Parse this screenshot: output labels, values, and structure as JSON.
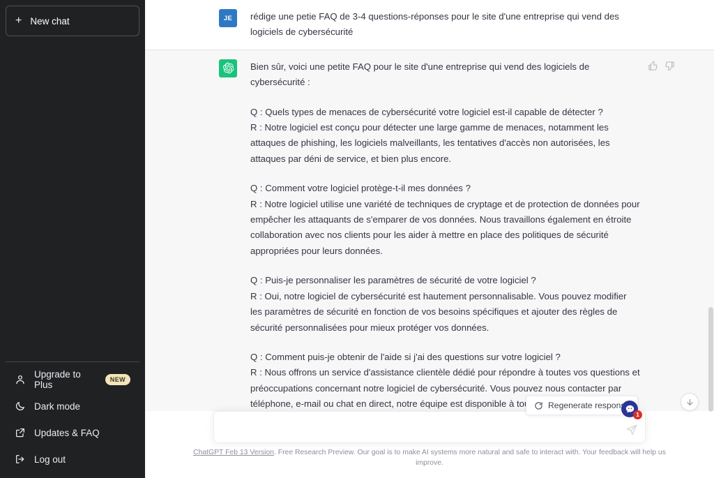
{
  "sidebar": {
    "new_chat": {
      "label": "New chat",
      "icon": "plus-icon"
    },
    "items": [
      {
        "label": "Upgrade to Plus",
        "icon": "user-icon",
        "badge": "NEW"
      },
      {
        "label": "Dark mode",
        "icon": "moon-icon",
        "badge": ""
      },
      {
        "label": "Updates & FAQ",
        "icon": "external-link-icon",
        "badge": ""
      },
      {
        "label": "Log out",
        "icon": "logout-icon",
        "badge": ""
      }
    ]
  },
  "colors": {
    "sidebar_bg": "#202123",
    "assistant_row_bg": "#f7f7f8",
    "bot_avatar": "#19c37d",
    "user_avatar": "#2f79c4",
    "badge_new_bg": "#f3e4bb",
    "notification_badge": "#d93025"
  },
  "conversation": {
    "user_message": {
      "avatar_initials": "JE",
      "text": "rédige une petie FAQ de 3-4 questions-réponses pour le site d'une entreprise qui vend des logiciels de cybersécurité"
    },
    "assistant_message": {
      "avatar_icon": "openai-logo-icon",
      "intro": "Bien sûr, voici une petite FAQ pour le site d'une entreprise qui vend des logiciels de cybersécurité :",
      "qa": [
        {
          "question": "Q : Quels types de menaces de cybersécurité votre logiciel est-il capable de détecter ?",
          "answer": "R : Notre logiciel est conçu pour détecter une large gamme de menaces, notamment les attaques de phishing, les logiciels malveillants, les tentatives d'accès non autorisées, les attaques par déni de service, et bien plus encore."
        },
        {
          "question": "Q : Comment votre logiciel protège-t-il mes données ?",
          "answer": "R : Notre logiciel utilise une variété de techniques de cryptage et de protection de données pour empêcher les attaquants de s'emparer de vos données. Nous travaillons également en étroite collaboration avec nos clients pour les aider à mettre en place des politiques de sécurité appropriées pour leurs données."
        },
        {
          "question": "Q : Puis-je personnaliser les paramètres de sécurité de votre logiciel ?",
          "answer": "R : Oui, notre logiciel de cybersécurité est hautement personnalisable. Vous pouvez modifier les paramètres de sécurité en fonction de vos besoins spécifiques et ajouter des règles de sécurité personnalisées pour mieux protéger vos données."
        },
        {
          "question": "Q : Comment puis-je obtenir de l'aide si j'ai des questions sur votre logiciel ?",
          "answer": "R : Nous offrons un service d'assistance clientèle dédié pour répondre à toutes vos questions et préoccupations concernant notre logiciel de cybersécurité. Vous pouvez nous contacter par téléphone, e-mail ou chat en direct, notre équipe est disponible à tout moment."
        }
      ],
      "feedback": {
        "thumbs_up": "thumbs-up-icon",
        "thumbs_down": "thumbs-down-icon"
      }
    }
  },
  "controls": {
    "regenerate": {
      "label": "Regenerate response",
      "icon": "refresh-icon"
    },
    "scroll_to_bottom": {
      "icon": "arrow-down-icon"
    }
  },
  "composer": {
    "value": "",
    "placeholder": "",
    "send_icon": "send-plane-icon",
    "extension": {
      "icon": "chat-bubble-icon",
      "badge_count": "1"
    }
  },
  "footer": {
    "link_text": "ChatGPT Feb 13 Version",
    "text": ". Free Research Preview. Our goal is to make AI systems more natural and safe to interact with. Your feedback will help us improve."
  }
}
